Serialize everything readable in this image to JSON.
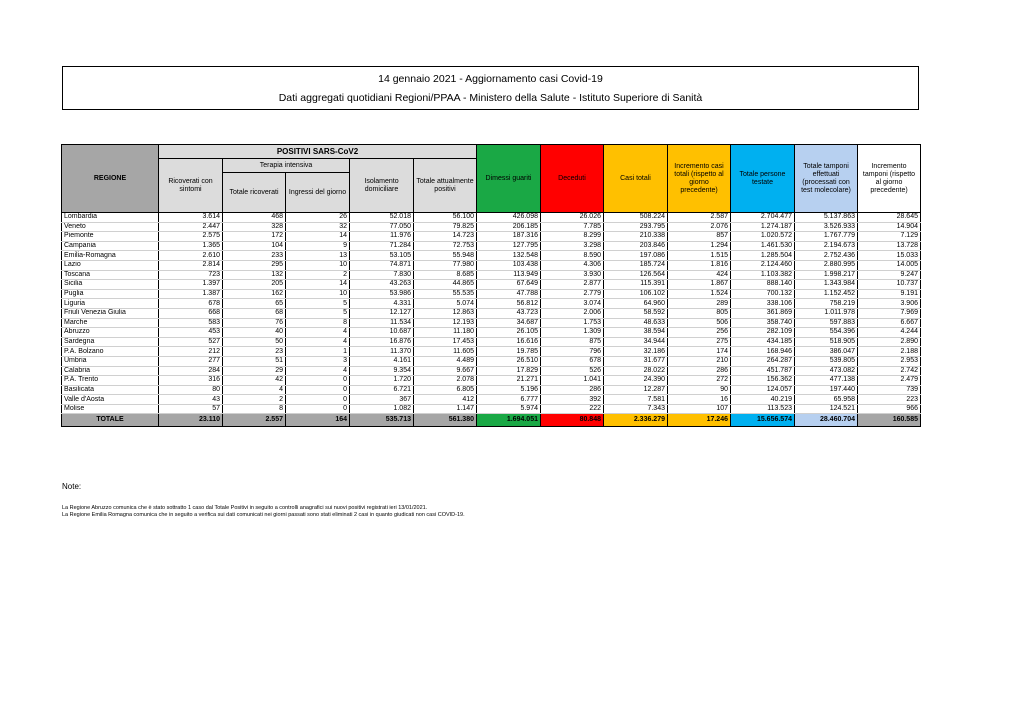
{
  "header": {
    "title": "14 gennaio 2021 - Aggiornamento casi Covid-19",
    "subtitle": "Dati aggregati quotidiani Regioni/PPAA - Ministero della Salute - Istituto Superiore di Sanità"
  },
  "table": {
    "headers": {
      "regione": "REGIONE",
      "positivi": "POSITIVI SARS-CoV2",
      "ricoverati": "Ricoverati con sintomi",
      "terapia": "Terapia intensiva",
      "totale_ricoverati": "Totale ricoverati",
      "ingressi": "Ingressi del giorno",
      "isolamento": "Isolamento domiciliare",
      "totale_positivi": "Totale attualmente positivi",
      "dimessi": "Dimessi guariti",
      "deceduti": "Deceduti",
      "casi_totali": "Casi totali",
      "incremento_casi": "Incremento casi totali (rispetto al giorno precedente)",
      "persone_testate": "Totale persone testate",
      "tamponi": "Totale tamponi effettuati (processati con test molecolare)",
      "incremento_tamponi": "Incremento tamponi (rispetto al giorno precedente)"
    },
    "rows": [
      [
        "Lombardia",
        "3.614",
        "468",
        "26",
        "52.018",
        "56.100",
        "426.098",
        "26.026",
        "508.224",
        "2.587",
        "2.704.477",
        "5.137.863",
        "28.645"
      ],
      [
        "Veneto",
        "2.447",
        "328",
        "32",
        "77.050",
        "79.825",
        "206.185",
        "7.785",
        "293.795",
        "2.076",
        "1.274.187",
        "3.526.933",
        "14.904"
      ],
      [
        "Piemonte",
        "2.575",
        "172",
        "14",
        "11.976",
        "14.723",
        "187.316",
        "8.299",
        "210.338",
        "857",
        "1.020.572",
        "1.767.779",
        "7.129"
      ],
      [
        "Campania",
        "1.365",
        "104",
        "9",
        "71.284",
        "72.753",
        "127.795",
        "3.298",
        "203.846",
        "1.294",
        "1.461.530",
        "2.194.673",
        "13.728"
      ],
      [
        "Emilia-Romagna",
        "2.610",
        "233",
        "13",
        "53.105",
        "55.948",
        "132.548",
        "8.590",
        "197.086",
        "1.515",
        "1.285.504",
        "2.752.436",
        "15.033"
      ],
      [
        "Lazio",
        "2.814",
        "295",
        "10",
        "74.871",
        "77.980",
        "103.438",
        "4.306",
        "185.724",
        "1.816",
        "2.124.460",
        "2.880.995",
        "14.005"
      ],
      [
        "Toscana",
        "723",
        "132",
        "2",
        "7.830",
        "8.685",
        "113.949",
        "3.930",
        "126.564",
        "424",
        "1.103.382",
        "1.998.217",
        "9.247"
      ],
      [
        "Sicilia",
        "1.397",
        "205",
        "14",
        "43.263",
        "44.865",
        "67.649",
        "2.877",
        "115.391",
        "1.867",
        "888.140",
        "1.343.984",
        "10.737"
      ],
      [
        "Puglia",
        "1.387",
        "162",
        "10",
        "53.986",
        "55.535",
        "47.788",
        "2.779",
        "106.102",
        "1.524",
        "700.132",
        "1.152.452",
        "9.191"
      ],
      [
        "Liguria",
        "678",
        "65",
        "5",
        "4.331",
        "5.074",
        "56.812",
        "3.074",
        "64.960",
        "289",
        "338.106",
        "758.219",
        "3.906"
      ],
      [
        "Friuli Venezia Giulia",
        "668",
        "68",
        "5",
        "12.127",
        "12.863",
        "43.723",
        "2.006",
        "58.592",
        "805",
        "361.869",
        "1.011.978",
        "7.969"
      ],
      [
        "Marche",
        "583",
        "76",
        "8",
        "11.534",
        "12.193",
        "34.687",
        "1.753",
        "48.633",
        "506",
        "358.740",
        "597.883",
        "6.667"
      ],
      [
        "Abruzzo",
        "453",
        "40",
        "4",
        "10.687",
        "11.180",
        "26.105",
        "1.309",
        "38.594",
        "256",
        "282.109",
        "554.396",
        "4.244"
      ],
      [
        "Sardegna",
        "527",
        "50",
        "4",
        "16.876",
        "17.453",
        "16.616",
        "875",
        "34.944",
        "275",
        "434.185",
        "518.905",
        "2.890"
      ],
      [
        "P.A. Bolzano",
        "212",
        "23",
        "1",
        "11.370",
        "11.605",
        "19.785",
        "796",
        "32.186",
        "174",
        "168.946",
        "386.047",
        "2.188"
      ],
      [
        "Umbria",
        "277",
        "51",
        "3",
        "4.161",
        "4.489",
        "26.510",
        "678",
        "31.677",
        "210",
        "264.287",
        "539.805",
        "2.953"
      ],
      [
        "Calabria",
        "284",
        "29",
        "4",
        "9.354",
        "9.667",
        "17.829",
        "526",
        "28.022",
        "286",
        "451.787",
        "473.082",
        "2.742"
      ],
      [
        "P.A. Trento",
        "316",
        "42",
        "0",
        "1.720",
        "2.078",
        "21.271",
        "1.041",
        "24.390",
        "272",
        "156.362",
        "477.138",
        "2.479"
      ],
      [
        "Basilicata",
        "80",
        "4",
        "0",
        "6.721",
        "6.805",
        "5.196",
        "286",
        "12.287",
        "90",
        "124.057",
        "197.440",
        "739"
      ],
      [
        "Valle d'Aosta",
        "43",
        "2",
        "0",
        "367",
        "412",
        "6.777",
        "392",
        "7.581",
        "16",
        "40.219",
        "65.958",
        "223"
      ],
      [
        "Molise",
        "57",
        "8",
        "0",
        "1.082",
        "1.147",
        "5.974",
        "222",
        "7.343",
        "107",
        "113.523",
        "124.521",
        "966"
      ]
    ],
    "totals": [
      "TOTALE",
      "23.110",
      "2.557",
      "164",
      "535.713",
      "561.380",
      "1.694.051",
      "80.848",
      "2.336.279",
      "17.246",
      "15.656.574",
      "28.460.704",
      "160.585"
    ]
  },
  "notes": {
    "title": "Note:",
    "lines": [
      "La Regione Abruzzo comunica che è stato sottratto 1 caso dal Totale Positivi in seguito a controlli anagrafici sui nuovi positivi registrati ieri 13/01/2021.",
      "La Regione Emilia Romagna comunica che in seguito a verifica sui dati comunicati nei giorni passati sono stati eliminati 2 casi in quanto giudicati non casi COVID-19."
    ]
  },
  "colors": {
    "dimessi": "#1aa845",
    "deceduti": "#ff0000",
    "casi_totali": "#ffc000",
    "persone_testate": "#00b0f0",
    "tamponi": "#b7d0f0",
    "header_grey": "#dcdcdc",
    "regione_grey": "#a6a6a6"
  }
}
